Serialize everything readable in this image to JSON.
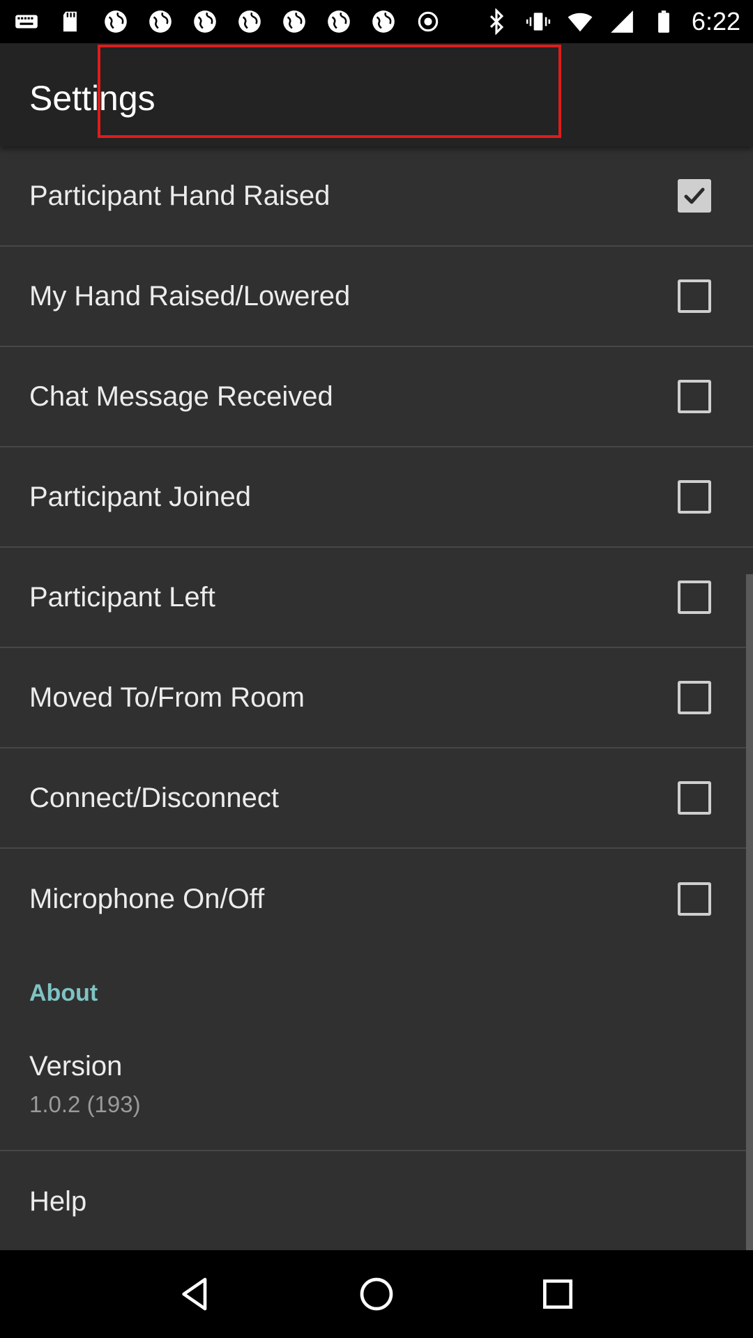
{
  "status_bar": {
    "time": "6:22",
    "left_icons": [
      "keyboard-icon",
      "sd-card-icon",
      "globe-icon",
      "globe-icon",
      "globe-icon",
      "globe-icon",
      "globe-icon",
      "globe-icon",
      "globe-icon",
      "record-icon"
    ],
    "right_icons": [
      "bluetooth-icon",
      "vibrate-icon",
      "wifi-icon",
      "signal-icon",
      "battery-icon"
    ]
  },
  "app_bar": {
    "title": "Settings"
  },
  "notifications": [
    {
      "label": "Participant Hand Raised",
      "checked": true
    },
    {
      "label": "My Hand Raised/Lowered",
      "checked": false
    },
    {
      "label": "Chat Message Received",
      "checked": false
    },
    {
      "label": "Participant Joined",
      "checked": false
    },
    {
      "label": "Participant Left",
      "checked": false
    },
    {
      "label": "Moved To/From Room",
      "checked": false
    },
    {
      "label": "Connect/Disconnect",
      "checked": false
    },
    {
      "label": "Microphone On/Off",
      "checked": false
    }
  ],
  "about": {
    "header": "About",
    "version_title": "Version",
    "version_value": "1.0.2 (193)",
    "help_label": "Help"
  },
  "colors": {
    "accent": "#7fc3c3",
    "highlight": "#e01b1b",
    "background": "#303030",
    "app_bar": "#232323"
  },
  "nav_bar": {
    "buttons": [
      "back-icon",
      "home-icon",
      "recents-icon"
    ]
  }
}
